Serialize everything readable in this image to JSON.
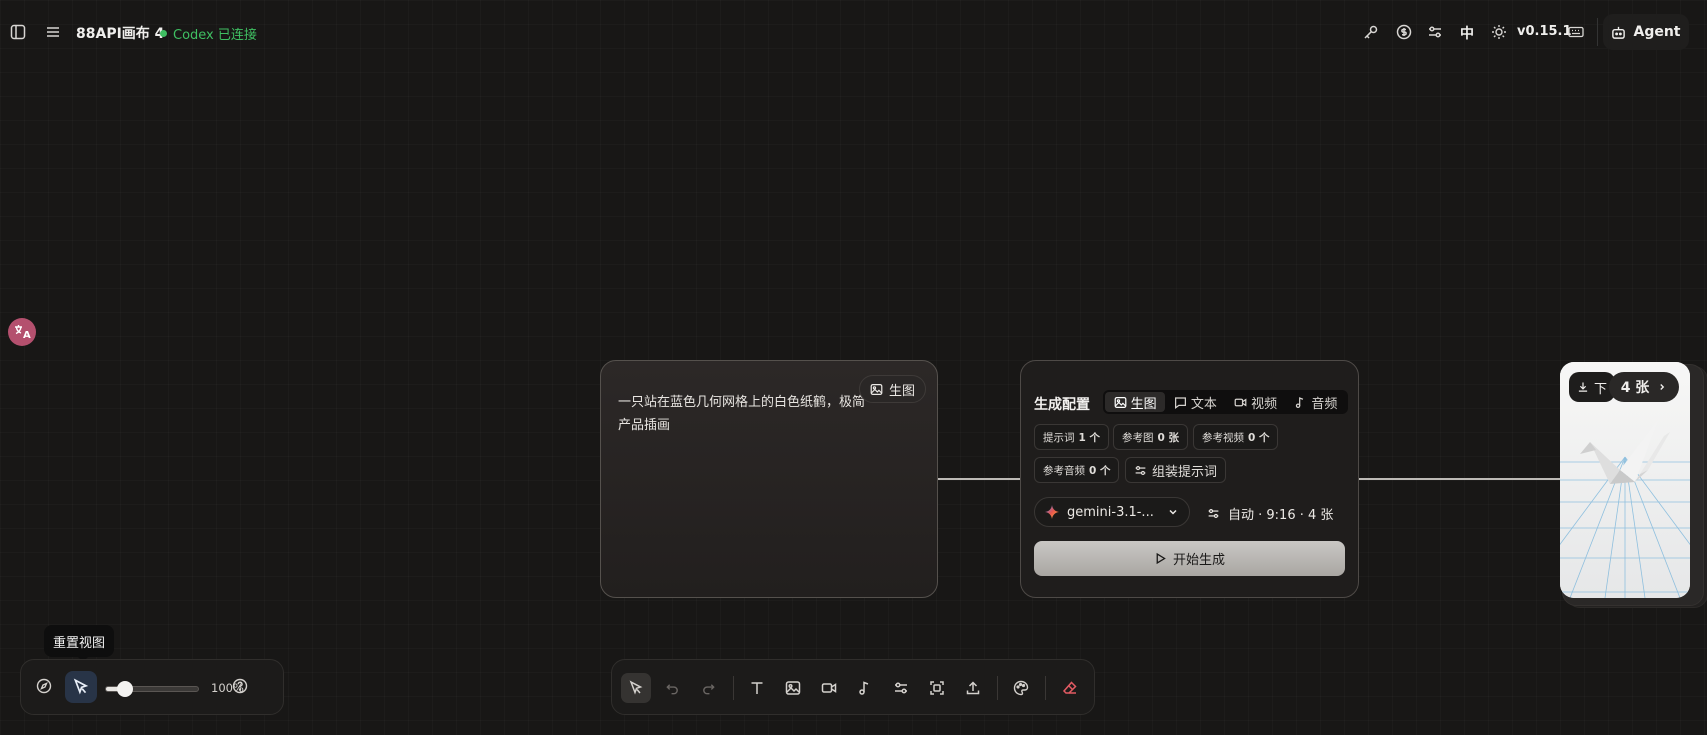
{
  "header": {
    "title": "88API画布 4",
    "connection_status": "Codex 已连接",
    "language": "中",
    "version": "v0.15.1",
    "agent_label": "Agent",
    "status_color": "#3fbf62",
    "icons": [
      "sidebar-toggle-icon",
      "menu-icon",
      "key-icon",
      "dollar-icon",
      "settings-sliders-icon",
      "theme-sun-icon",
      "keyboard-icon",
      "bot-icon"
    ]
  },
  "prompt_node": {
    "text": "一只站在蓝色几何网格上的白色纸鹤，极简产品插画",
    "type_label": "生图"
  },
  "config_node": {
    "title": "生成配置",
    "tabs": [
      {
        "label": "生图",
        "icon": "image-icon",
        "active": true
      },
      {
        "label": "文本",
        "icon": "message-icon",
        "active": false
      },
      {
        "label": "视频",
        "icon": "video-icon",
        "active": false
      },
      {
        "label": "音频",
        "icon": "music-icon",
        "active": false
      }
    ],
    "chips": [
      {
        "label": "提示词",
        "value": "1 个"
      },
      {
        "label": "参考图",
        "value": "0 张"
      },
      {
        "label": "参考视频",
        "value": "0 个"
      },
      {
        "label": "参考音频",
        "value": "0 个"
      }
    ],
    "assemble_label": "组装提示词",
    "model": "gemini-3.1-...",
    "settings_summary": "自动 · 9:16 · 4 张",
    "start_label": "开始生成"
  },
  "output_node": {
    "download_label": "下",
    "count_label": "4 张"
  },
  "view_controls": {
    "tooltip": "重置视图",
    "zoom_label": "100%",
    "zoom_slider_fraction": 0.2
  },
  "toolbar": {
    "tools": [
      "select-tool",
      "undo",
      "redo",
      "text-tool",
      "image-tool",
      "video-tool",
      "audio-tool",
      "config-tool",
      "frame-tool",
      "upload-tool",
      "palette-tool",
      "eraser-tool"
    ]
  },
  "translate_badge": "A"
}
